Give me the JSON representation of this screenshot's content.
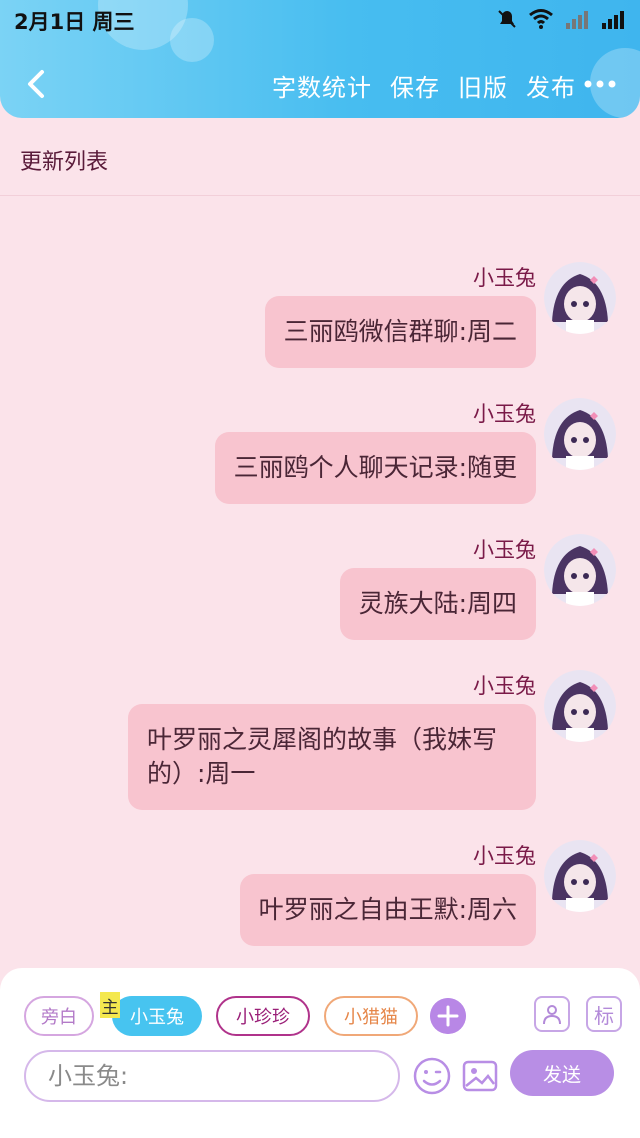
{
  "status_bar": {
    "time": "2月1日 周三"
  },
  "header": {
    "actions": [
      "字数统计",
      "保存",
      "旧版",
      "发布"
    ]
  },
  "update_list": {
    "label": "更新列表"
  },
  "messages": [
    {
      "name": "小玉兔",
      "text": "三丽鸥微信群聊:周二"
    },
    {
      "name": "小玉兔",
      "text": "三丽鸥个人聊天记录:随更"
    },
    {
      "name": "小玉兔",
      "text": "灵族大陆:周四"
    },
    {
      "name": "小玉兔",
      "text": "叶罗丽之灵犀阁的故事（我妹写的）:周一"
    },
    {
      "name": "小玉兔",
      "text": "叶罗丽之自由王默:周六"
    }
  ],
  "roles": {
    "narrator": "旁白",
    "main_tag": "主",
    "main": "小玉兔",
    "zhenzhen": "小珍珍",
    "liemao": "小猎猫"
  },
  "side_buttons": {
    "mark": "标"
  },
  "composer": {
    "placeholder": "小玉兔:",
    "send_label": "发送"
  },
  "colors": {
    "header_accent": "#47bdf0",
    "bubble": "#f8c4cf",
    "send": "#b88ee5"
  }
}
